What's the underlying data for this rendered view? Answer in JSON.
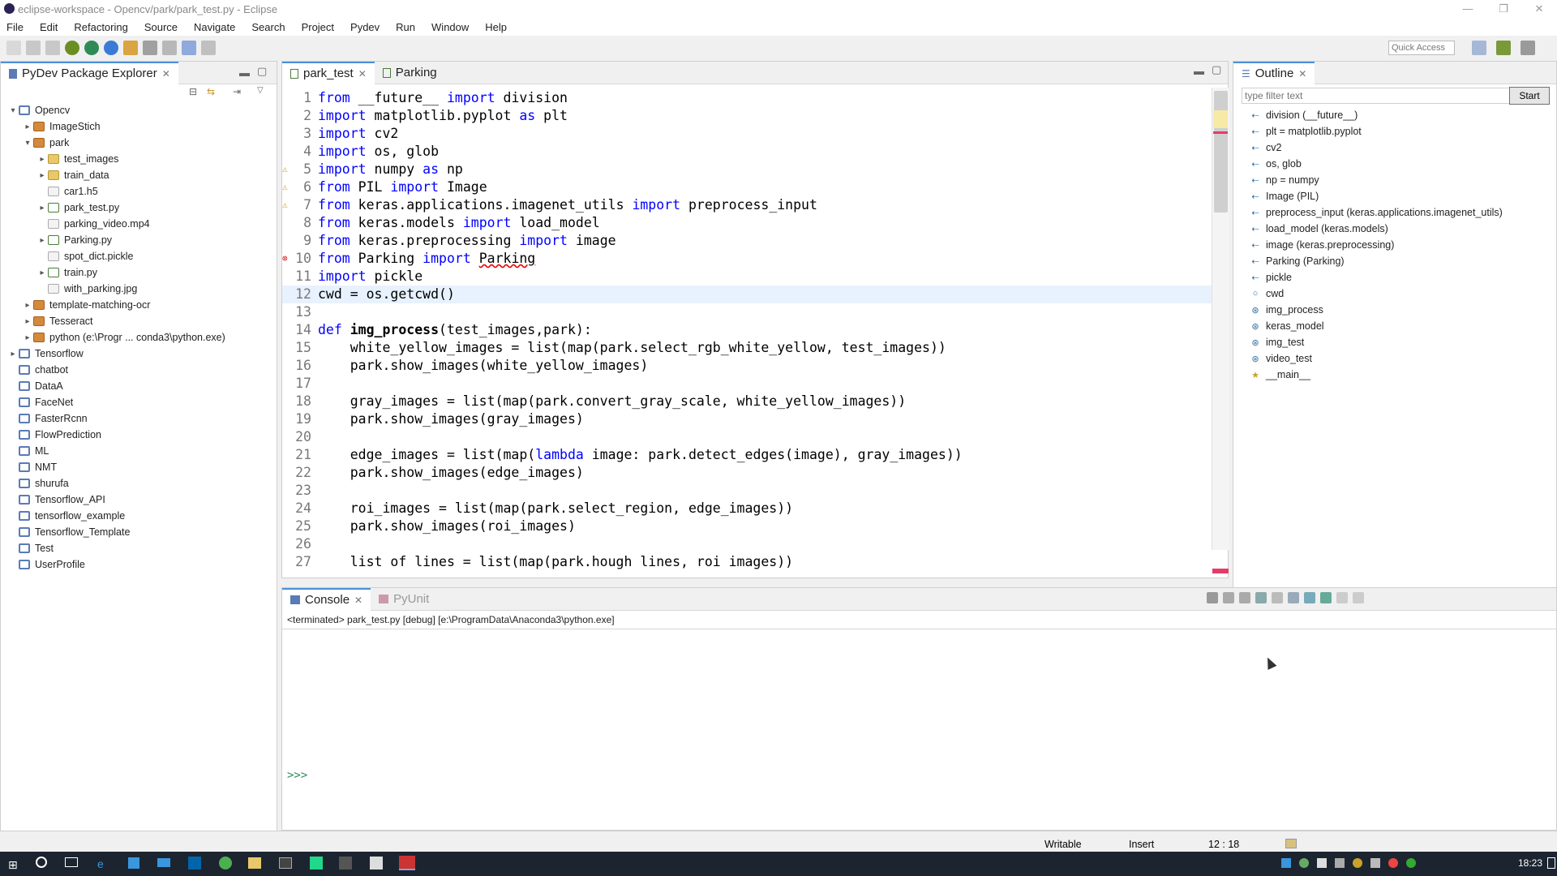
{
  "window": {
    "title": "eclipse-workspace - Opencv/park/park_test.py - Eclipse",
    "controls": [
      "—",
      "❐",
      "✕"
    ]
  },
  "menu": [
    "File",
    "Edit",
    "Refactoring",
    "Source",
    "Navigate",
    "Search",
    "Project",
    "Pydev",
    "Run",
    "Window",
    "Help"
  ],
  "toolbar": {
    "quick_access_label": "Quick Access"
  },
  "explorer": {
    "title": "PyDev Package Explorer",
    "items": [
      {
        "label": "Opencv",
        "depth": 0,
        "arrow": "▾",
        "icon": "proj"
      },
      {
        "label": "ImageStich",
        "depth": 1,
        "arrow": "▸",
        "icon": "pkg"
      },
      {
        "label": "park",
        "depth": 1,
        "arrow": "▾",
        "icon": "pkg"
      },
      {
        "label": "test_images",
        "depth": 2,
        "arrow": "▸",
        "icon": "folder"
      },
      {
        "label": "train_data",
        "depth": 2,
        "arrow": "▸",
        "icon": "folder"
      },
      {
        "label": "car1.h5",
        "depth": 2,
        "arrow": "",
        "icon": "genfile"
      },
      {
        "label": "park_test.py",
        "depth": 2,
        "arrow": "▸",
        "icon": "pyfile"
      },
      {
        "label": "parking_video.mp4",
        "depth": 2,
        "arrow": "",
        "icon": "genfile"
      },
      {
        "label": "Parking.py",
        "depth": 2,
        "arrow": "▸",
        "icon": "pyfile"
      },
      {
        "label": "spot_dict.pickle",
        "depth": 2,
        "arrow": "",
        "icon": "genfile"
      },
      {
        "label": "train.py",
        "depth": 2,
        "arrow": "▸",
        "icon": "pyfile"
      },
      {
        "label": "with_parking.jpg",
        "depth": 2,
        "arrow": "",
        "icon": "genfile"
      },
      {
        "label": "template-matching-ocr",
        "depth": 1,
        "arrow": "▸",
        "icon": "pkg"
      },
      {
        "label": "Tesseract",
        "depth": 1,
        "arrow": "▸",
        "icon": "pkg"
      },
      {
        "label": "python  (e:\\Progr ... conda3\\python.exe)",
        "depth": 1,
        "arrow": "▸",
        "icon": "pkg"
      },
      {
        "label": "Tensorflow",
        "depth": 0,
        "arrow": "▸",
        "icon": "proj"
      },
      {
        "label": "chatbot",
        "depth": 0,
        "arrow": "",
        "icon": "proj"
      },
      {
        "label": "DataA",
        "depth": 0,
        "arrow": "",
        "icon": "proj"
      },
      {
        "label": "FaceNet",
        "depth": 0,
        "arrow": "",
        "icon": "proj"
      },
      {
        "label": "FasterRcnn",
        "depth": 0,
        "arrow": "",
        "icon": "proj"
      },
      {
        "label": "FlowPrediction",
        "depth": 0,
        "arrow": "",
        "icon": "proj"
      },
      {
        "label": "ML",
        "depth": 0,
        "arrow": "",
        "icon": "proj"
      },
      {
        "label": "NMT",
        "depth": 0,
        "arrow": "",
        "icon": "proj"
      },
      {
        "label": "shurufa",
        "depth": 0,
        "arrow": "",
        "icon": "proj"
      },
      {
        "label": "Tensorflow_API",
        "depth": 0,
        "arrow": "",
        "icon": "proj"
      },
      {
        "label": "tensorflow_example",
        "depth": 0,
        "arrow": "",
        "icon": "proj"
      },
      {
        "label": "Tensorflow_Template",
        "depth": 0,
        "arrow": "",
        "icon": "proj"
      },
      {
        "label": "Test",
        "depth": 0,
        "arrow": "",
        "icon": "proj"
      },
      {
        "label": "UserProfile",
        "depth": 0,
        "arrow": "",
        "icon": "proj"
      }
    ]
  },
  "editor": {
    "tabs": [
      {
        "label": "park_test",
        "active": true
      },
      {
        "label": "Parking",
        "active": false
      }
    ],
    "current_line": 12,
    "lines": [
      [
        {
          "t": "from",
          "k": 1
        },
        {
          "t": " __future__ "
        },
        {
          "t": "import",
          "k": 1
        },
        {
          "t": " division"
        }
      ],
      [
        {
          "t": "import",
          "k": 1
        },
        {
          "t": " matplotlib.pyplot "
        },
        {
          "t": "as",
          "k": 1
        },
        {
          "t": " plt"
        }
      ],
      [
        {
          "t": "import",
          "k": 1
        },
        {
          "t": " cv2"
        }
      ],
      [
        {
          "t": "import",
          "k": 1
        },
        {
          "t": " os, glob"
        }
      ],
      [
        {
          "t": "import",
          "k": 1
        },
        {
          "t": " numpy "
        },
        {
          "t": "as",
          "k": 1
        },
        {
          "t": " np"
        }
      ],
      [
        {
          "t": "from",
          "k": 1
        },
        {
          "t": " PIL "
        },
        {
          "t": "import",
          "k": 1
        },
        {
          "t": " Image"
        }
      ],
      [
        {
          "t": "from",
          "k": 1
        },
        {
          "t": " keras.applications.imagenet_utils "
        },
        {
          "t": "import",
          "k": 1
        },
        {
          "t": " preprocess_input"
        }
      ],
      [
        {
          "t": "from",
          "k": 1
        },
        {
          "t": " keras.models "
        },
        {
          "t": "import",
          "k": 1
        },
        {
          "t": " load_model"
        }
      ],
      [
        {
          "t": "from",
          "k": 1
        },
        {
          "t": " keras.preprocessing "
        },
        {
          "t": "import",
          "k": 1
        },
        {
          "t": " image"
        }
      ],
      [
        {
          "t": "from",
          "k": 1
        },
        {
          "t": " Parking "
        },
        {
          "t": "import",
          "k": 1
        },
        {
          "t": " "
        },
        {
          "t": "Parking",
          "e": 1
        }
      ],
      [
        {
          "t": "import",
          "k": 1
        },
        {
          "t": " pickle"
        }
      ],
      [
        {
          "t": "cwd = os.getcwd()"
        }
      ],
      [],
      [
        {
          "t": "def",
          "k": 1
        },
        {
          "t": " "
        },
        {
          "t": "img_process",
          "b": 1
        },
        {
          "t": "(test_images,park):"
        }
      ],
      [
        {
          "t": "    white_yellow_images = list(map(park.select_rgb_white_yellow, test_images))"
        }
      ],
      [
        {
          "t": "    park.show_images(white_yellow_images)"
        }
      ],
      [],
      [
        {
          "t": "    gray_images = list(map(park.convert_gray_scale, white_yellow_images))"
        }
      ],
      [
        {
          "t": "    park.show_images(gray_images)"
        }
      ],
      [],
      [
        {
          "t": "    edge_images = list(map("
        },
        {
          "t": "lambda",
          "k": 1
        },
        {
          "t": " image: park.detect_edges(image), gray_images))"
        }
      ],
      [
        {
          "t": "    park.show_images(edge_images)"
        }
      ],
      [],
      [
        {
          "t": "    roi_images = list(map(park.select_region, edge_images))"
        }
      ],
      [
        {
          "t": "    park.show_images(roi_images)"
        }
      ],
      [],
      [
        {
          "t": "    list of lines = list(map(park.hough lines, roi images))"
        }
      ]
    ]
  },
  "outline": {
    "title": "Outline",
    "filter_placeholder": "type filter text",
    "start_button": "Start",
    "items": [
      {
        "label": "division (__future__)",
        "icon": "import"
      },
      {
        "label": "plt = matplotlib.pyplot",
        "icon": "import"
      },
      {
        "label": "cv2",
        "icon": "import"
      },
      {
        "label": "os, glob",
        "icon": "import"
      },
      {
        "label": "np = numpy",
        "icon": "import"
      },
      {
        "label": "Image (PIL)",
        "icon": "import"
      },
      {
        "label": "preprocess_input (keras.applications.imagenet_utils)",
        "icon": "import"
      },
      {
        "label": "load_model (keras.models)",
        "icon": "import"
      },
      {
        "label": "image (keras.preprocessing)",
        "icon": "import"
      },
      {
        "label": "Parking (Parking)",
        "icon": "import"
      },
      {
        "label": "pickle",
        "icon": "import"
      },
      {
        "label": "cwd",
        "icon": "attr"
      },
      {
        "label": "img_process",
        "icon": "func"
      },
      {
        "label": "keras_model",
        "icon": "func"
      },
      {
        "label": "img_test",
        "icon": "func"
      },
      {
        "label": "video_test",
        "icon": "func"
      },
      {
        "label": "__main__",
        "icon": "main"
      }
    ]
  },
  "console": {
    "tabs": [
      {
        "label": "Console",
        "active": true
      },
      {
        "label": "PyUnit",
        "active": false
      }
    ],
    "status": "<terminated> park_test.py [debug] [e:\\ProgramData\\Anaconda3\\python.exe]",
    "prompt": ">>>"
  },
  "status": {
    "writable": "Writable",
    "insert": "Insert",
    "position": "12 : 18"
  },
  "taskbar": {
    "clock": "18:23"
  },
  "colors": {
    "keyword": "#0000ff",
    "accent": "#4a90d9",
    "error": "#e00000",
    "taskbar": "#1c2430"
  }
}
